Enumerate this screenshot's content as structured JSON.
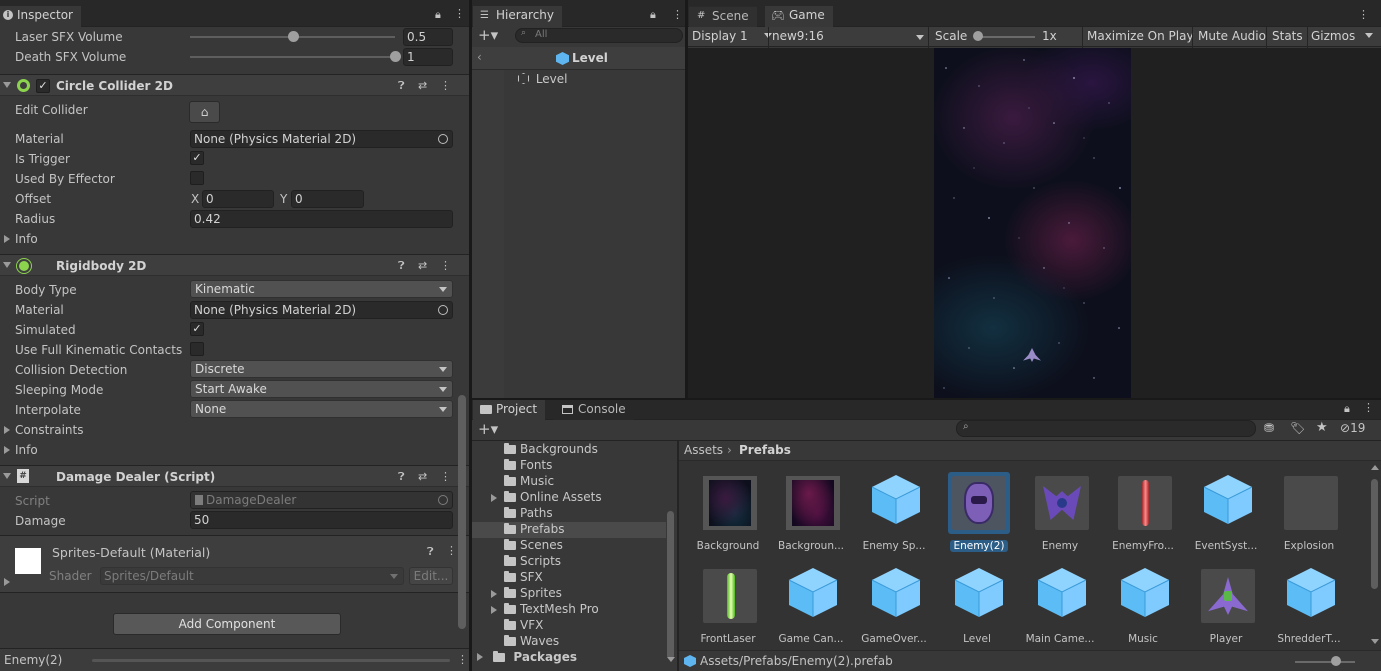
{
  "inspector": {
    "tab_label": "Inspector",
    "laser_sfx": {
      "label": "Laser SFX Volume",
      "value": "0.5",
      "fraction": 0.5
    },
    "death_sfx": {
      "label": "Death SFX Volume",
      "value": "1",
      "fraction": 1.0
    },
    "circle_collider": {
      "title": "Circle Collider 2D",
      "edit_collider": "Edit Collider",
      "material_label": "Material",
      "material_value": "None (Physics Material 2D)",
      "is_trigger": "Is Trigger",
      "used_by_effector": "Used By Effector",
      "offset": "Offset",
      "offset_x_label": "X",
      "offset_x": "0",
      "offset_y_label": "Y",
      "offset_y": "0",
      "radius": "Radius",
      "radius_value": "0.42",
      "info": "Info"
    },
    "rigidbody": {
      "title": "Rigidbody 2D",
      "body_type": "Body Type",
      "body_type_value": "Kinematic",
      "material": "Material",
      "material_value": "None (Physics Material 2D)",
      "simulated": "Simulated",
      "full_kinematic": "Use Full Kinematic Contacts",
      "collision": "Collision Detection",
      "collision_value": "Discrete",
      "sleeping": "Sleeping Mode",
      "sleeping_value": "Start Awake",
      "interpolate": "Interpolate",
      "interpolate_value": "None",
      "constraints": "Constraints",
      "info": "Info"
    },
    "damage_dealer": {
      "title": "Damage Dealer (Script)",
      "script": "Script",
      "script_value": "DamageDealer",
      "damage": "Damage",
      "damage_value": "50"
    },
    "material": {
      "title": "Sprites-Default (Material)",
      "shader": "Shader",
      "shader_value": "Sprites/Default",
      "edit": "Edit..."
    },
    "add_component": "Add Component",
    "footer": "Enemy(2)"
  },
  "hierarchy": {
    "tab_label": "Hierarchy",
    "search_placeholder": "All",
    "scene_header": "Level",
    "items": [
      "Level"
    ]
  },
  "game": {
    "scene_tab": "Scene",
    "game_tab": "Game",
    "display": "Display 1",
    "aspect": "new9:16",
    "scale_label": "Scale",
    "scale_value": "1x",
    "maximize": "Maximize On Play",
    "mute": "Mute Audio",
    "stats": "Stats",
    "gizmos": "Gizmos"
  },
  "project": {
    "project_tab": "Project",
    "console_tab": "Console",
    "hidden_count": "19",
    "breadcrumb_root": "Assets",
    "breadcrumb_current": "Prefabs",
    "folders": [
      {
        "name": "Backgrounds",
        "expandable": false
      },
      {
        "name": "Fonts",
        "expandable": false
      },
      {
        "name": "Music",
        "expandable": false
      },
      {
        "name": "Online Assets",
        "expandable": true
      },
      {
        "name": "Paths",
        "expandable": false
      },
      {
        "name": "Prefabs",
        "expandable": false,
        "selected": true
      },
      {
        "name": "Scenes",
        "expandable": false
      },
      {
        "name": "Scripts",
        "expandable": false
      },
      {
        "name": "SFX",
        "expandable": false
      },
      {
        "name": "Sprites",
        "expandable": true
      },
      {
        "name": "TextMesh Pro",
        "expandable": true
      },
      {
        "name": "VFX",
        "expandable": false
      },
      {
        "name": "Waves",
        "expandable": false
      }
    ],
    "packages": "Packages",
    "assets_row1": [
      {
        "name": "Background",
        "kind": "bg1"
      },
      {
        "name": "Backgroun...",
        "kind": "bg2"
      },
      {
        "name": "Enemy Sp...",
        "kind": "cube"
      },
      {
        "name": "Enemy(2)",
        "kind": "enemy2",
        "selected": true
      },
      {
        "name": "Enemy",
        "kind": "enemy"
      },
      {
        "name": "EnemyFro...",
        "kind": "redlaser"
      },
      {
        "name": "EventSyst...",
        "kind": "cube"
      },
      {
        "name": "Explosion",
        "kind": "blank"
      }
    ],
    "assets_row2": [
      {
        "name": "FrontLaser",
        "kind": "greenlaser"
      },
      {
        "name": "Game Can...",
        "kind": "cube"
      },
      {
        "name": "GameOver...",
        "kind": "cube"
      },
      {
        "name": "Level",
        "kind": "cube"
      },
      {
        "name": "Main Came...",
        "kind": "cube"
      },
      {
        "name": "Music",
        "kind": "cube"
      },
      {
        "name": "Player",
        "kind": "player"
      },
      {
        "name": "ShredderT...",
        "kind": "cube"
      }
    ],
    "path": "Assets/Prefabs/Enemy(2).prefab"
  }
}
